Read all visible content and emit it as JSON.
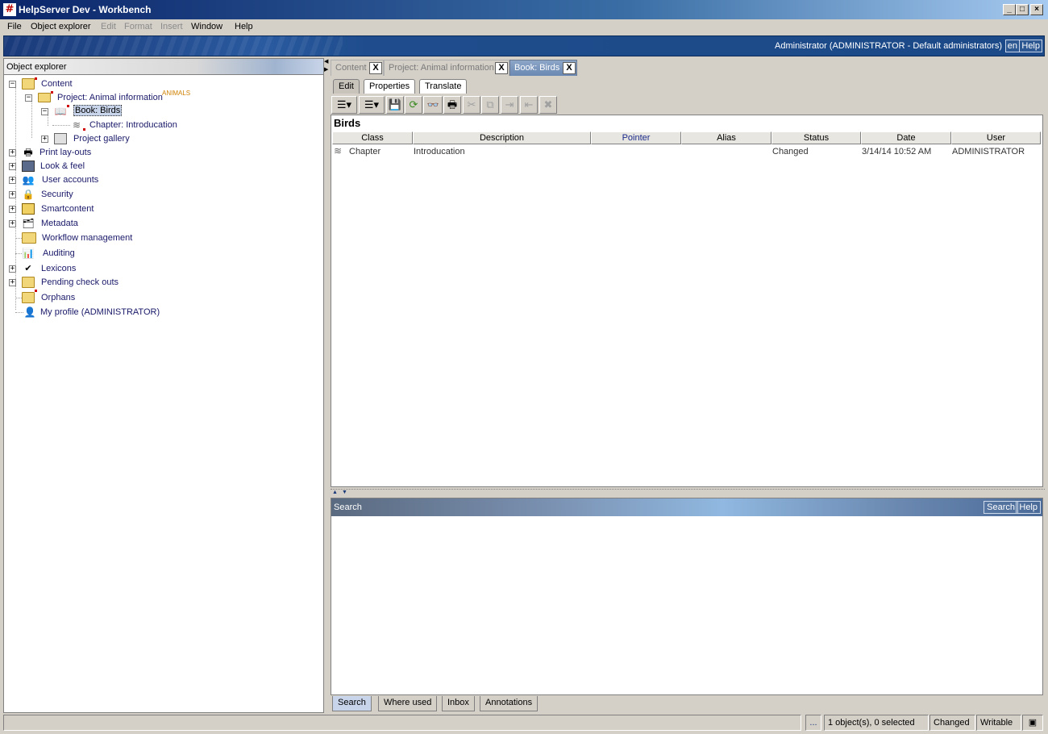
{
  "window": {
    "title": "HelpServer Dev - Workbench",
    "min": "_",
    "max": "□",
    "close": "×",
    "app_icon_glyph": "#"
  },
  "menu": [
    {
      "label": "File",
      "enabled": true
    },
    {
      "label": "Object explorer",
      "enabled": true
    },
    {
      "label": "Edit",
      "enabled": false
    },
    {
      "label": "Format",
      "enabled": false
    },
    {
      "label": "Insert",
      "enabled": false
    },
    {
      "label": "Window",
      "enabled": true
    },
    {
      "label": "Help",
      "enabled": true
    }
  ],
  "banner": {
    "user": "Administrator (ADMINISTRATOR - Default administrators)",
    "lang": "en",
    "help": "Help"
  },
  "explorer": {
    "title": "Object explorer",
    "tree": {
      "content": "Content",
      "project": "Project: Animal information",
      "project_tag": "ANIMALS",
      "book": "Book: Birds",
      "chapter": "Chapter: Introducation",
      "gallery": "Project gallery",
      "print": "Print lay-outs",
      "look": "Look & feel",
      "users": "User accounts",
      "security": "Security",
      "smart": "Smartcontent",
      "metadata": "Metadata",
      "workflow": "Workflow management",
      "auditing": "Auditing",
      "lexicons": "Lexicons",
      "pending": "Pending check outs",
      "orphans": "Orphans",
      "profile": "My profile (ADMINISTRATOR)"
    }
  },
  "doc_tabs": [
    {
      "label": "Content",
      "active": false
    },
    {
      "label": "Project: Animal information",
      "active": false
    },
    {
      "label": "Book: Birds",
      "active": true
    }
  ],
  "close_glyph": "X",
  "sub_tabs": [
    {
      "label": "Edit",
      "active": true
    },
    {
      "label": "Properties",
      "active": false
    },
    {
      "label": "Translate",
      "active": false
    }
  ],
  "toolbar_icons": [
    "list-dropdown-icon",
    "list-dropdown-icon-2",
    "save-icon",
    "refresh-icon",
    "preview-icon",
    "print-icon",
    "cut-icon",
    "copy-icon",
    "indent-icon",
    "outdent-icon",
    "delete-icon"
  ],
  "content": {
    "heading": "Birds",
    "columns": [
      "Class",
      "Description",
      "Pointer",
      "Alias",
      "Status",
      "Date",
      "User"
    ],
    "rows": [
      {
        "class": "Chapter",
        "description": "Introducation",
        "pointer": "",
        "alias": "",
        "status": "Changed",
        "date": "3/14/14 10:52 AM",
        "user": "ADMINISTRATOR"
      }
    ]
  },
  "search_panel": {
    "title": "Search",
    "search_btn": "Search",
    "help_btn": "Help"
  },
  "bottom_tabs": [
    {
      "label": "Search",
      "active": true
    },
    {
      "label": "Where used",
      "active": false
    },
    {
      "label": "Inbox",
      "active": false
    },
    {
      "label": "Annotations",
      "active": false
    }
  ],
  "status": {
    "dots": "...",
    "selection": "1 object(s), 0 selected",
    "state": "Changed",
    "mode": "Writable"
  }
}
